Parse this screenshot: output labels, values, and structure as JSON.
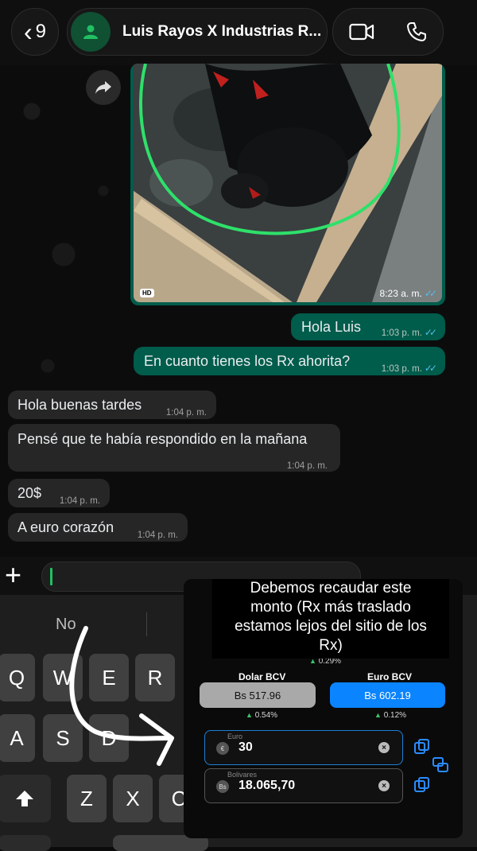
{
  "header": {
    "back_count": "9",
    "contact_name": "Luis Rayos X Industrias R...",
    "video_icon": "video-camera-icon",
    "call_icon": "phone-icon"
  },
  "image_message": {
    "time": "8:23 a. m.",
    "badge": "HD",
    "forward_icon": "forward-arrow-icon"
  },
  "messages": [
    {
      "dir": "out",
      "text": "Hola Luis",
      "time": "1:03 p. m."
    },
    {
      "dir": "out",
      "text": "En cuanto tienes los Rx ahorita?",
      "time": "1:03 p. m."
    },
    {
      "dir": "in",
      "text": "Hola buenas tardes",
      "time": "1:04 p. m."
    },
    {
      "dir": "in",
      "text": "Pensé que te había respondido en la mañana",
      "time": "1:04 p. m."
    },
    {
      "dir": "in",
      "text": "20$",
      "time": "1:04 p. m."
    },
    {
      "dir": "in",
      "text": "A euro corazón",
      "time": "1:04 p. m."
    }
  ],
  "keyboard": {
    "suggestion": "No",
    "row1": [
      "Q",
      "W",
      "E",
      "R"
    ],
    "row2": [
      "A",
      "S",
      "D"
    ],
    "row3": [
      "Z",
      "X",
      "C"
    ]
  },
  "overlay": {
    "note_lines": [
      "Debemos recaudar este",
      "monto (Rx más traslado",
      "estamos lejos del sitio de los",
      "Rx)"
    ],
    "top_pct": "0.29%",
    "dolar_label": "Dolar BCV",
    "dolar_value": "Bs 517.96",
    "dolar_pct": "0.54%",
    "euro_label": "Euro BCV",
    "euro_value": "Bs 602.19",
    "euro_pct": "0.12%",
    "euro_field_label": "Euro",
    "euro_field_symbol": "€",
    "euro_field_value": "30",
    "bs_field_label": "Bolivares",
    "bs_field_symbol": "Bs",
    "bs_field_value": "18.065,70",
    "colors": {
      "euro_button": "#0a84ff",
      "dolar_button": "#a9a9a9",
      "up": "#3cc36a"
    }
  }
}
